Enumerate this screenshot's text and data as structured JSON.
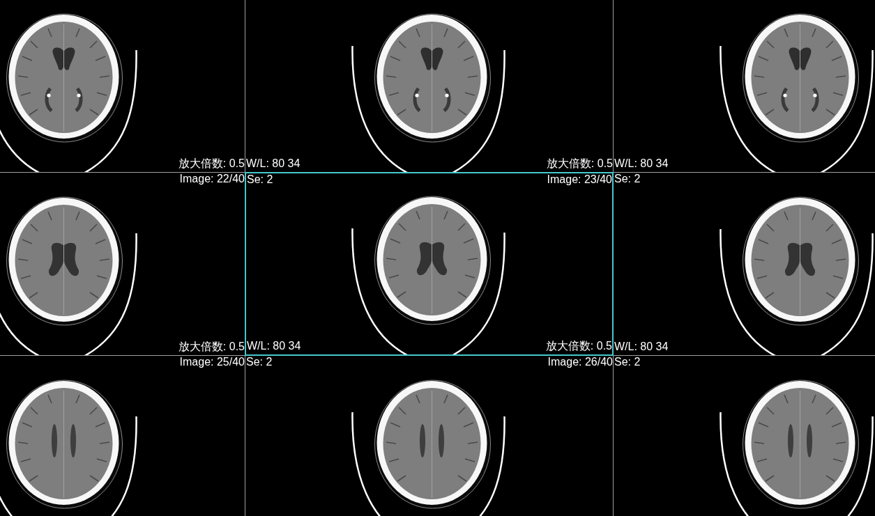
{
  "cells": [
    {
      "selected": false,
      "overlay": {
        "bottom_right": "放大倍数: 0.5"
      }
    },
    {
      "selected": false,
      "overlay": {
        "bottom_left": "W/L: 80 34",
        "bottom_right": "放大倍数: 0.5"
      }
    },
    {
      "selected": false,
      "overlay": {
        "bottom_left": "W/L: 80 34"
      }
    },
    {
      "selected": false,
      "overlay": {
        "top_right": "Image: 22/40",
        "bottom_right": "放大倍数: 0.5"
      }
    },
    {
      "selected": true,
      "overlay": {
        "top_left": "Se: 2",
        "top_right": "Image: 23/40",
        "bottom_left": "W/L: 80 34",
        "bottom_right": "放大倍数: 0.5"
      }
    },
    {
      "selected": false,
      "overlay": {
        "top_left": "Se: 2",
        "bottom_left": "W/L: 80 34"
      }
    },
    {
      "selected": false,
      "overlay": {
        "top_right": "Image: 25/40"
      }
    },
    {
      "selected": false,
      "overlay": {
        "top_left": "Se: 2",
        "top_right": "Image: 26/40"
      }
    },
    {
      "selected": false,
      "overlay": {
        "top_left": "Se: 2"
      }
    }
  ]
}
